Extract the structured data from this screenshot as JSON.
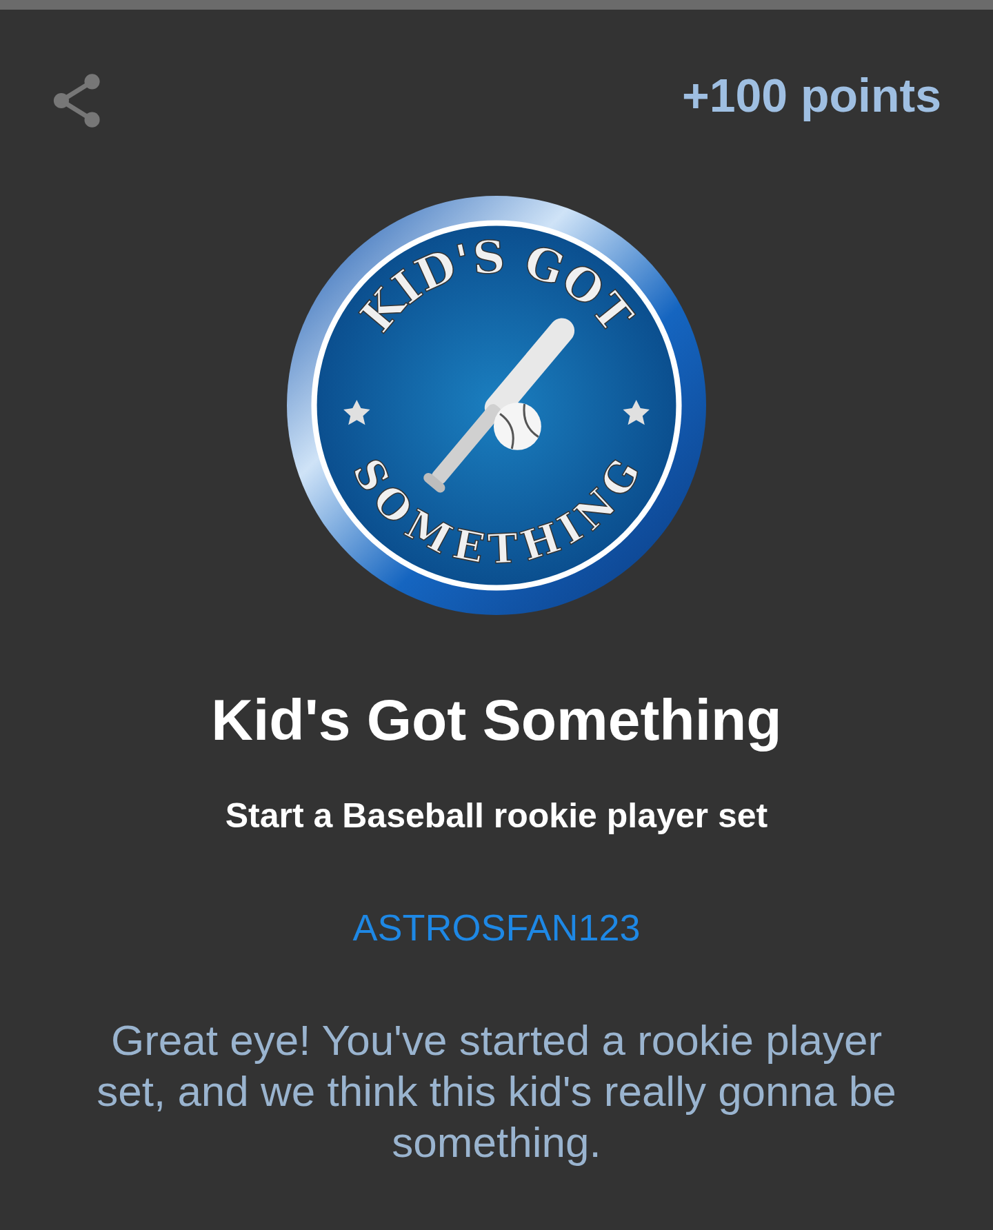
{
  "points": "+100 points",
  "badge": {
    "top_text": "KID'S GOT",
    "bottom_text": "SOMETHING"
  },
  "title": "Kid's Got Something",
  "subtitle": "Start a Baseball rookie player set",
  "username": "ASTROSFAN123",
  "description": "Great eye! You've started a rookie player set, and we think this kid's really gonna be something."
}
